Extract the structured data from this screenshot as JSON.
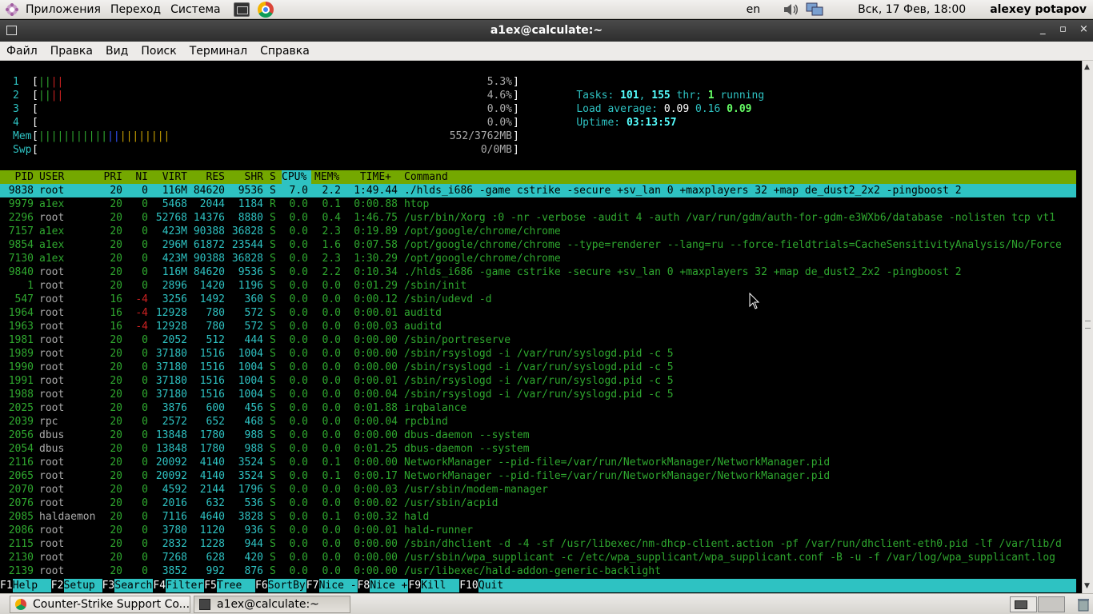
{
  "top_panel": {
    "menus": [
      "Приложения",
      "Переход",
      "Система"
    ],
    "keyboard_layout": "en",
    "clock": "Вск, 17 Фев, 18:00",
    "user": "alexey potapov",
    "launchers": [
      "terminal-launcher-icon",
      "chrome-launcher-icon"
    ]
  },
  "window": {
    "title": "a1ex@calculate:~",
    "controls": [
      "_",
      "▫",
      "×"
    ]
  },
  "menubar": [
    "Файл",
    "Правка",
    "Вид",
    "Поиск",
    "Терминал",
    "Справка"
  ],
  "htop": {
    "cpus": [
      {
        "label": "1",
        "bars": "||||",
        "percent": "5.3%"
      },
      {
        "label": "2",
        "bars": "||||",
        "percent": "4.6%"
      },
      {
        "label": "3",
        "bars": "",
        "percent": "0.0%"
      },
      {
        "label": "4",
        "bars": "",
        "percent": "0.0%"
      }
    ],
    "mem": {
      "label": "Mem",
      "bars": "||||||||||||||||||||||||||||||||||||||",
      "value": "552/3762MB"
    },
    "swp": {
      "label": "Swp",
      "value": "0/0MB"
    },
    "tasks": {
      "label": "Tasks: ",
      "count": "101",
      "sep": ", ",
      "threads": "155",
      "thr_label": " thr; ",
      "running": "1",
      "running_label": " running"
    },
    "load": {
      "label": "Load average: ",
      "l1": "0.09",
      "l5": "0.16",
      "l15": "0.09"
    },
    "uptime": {
      "label": "Uptime: ",
      "value": "03:13:57"
    },
    "columns": [
      "PID",
      "USER",
      "PRI",
      "NI",
      "VIRT",
      "RES",
      "SHR",
      "S",
      "CPU%",
      "MEM%",
      "TIME+",
      "Command"
    ],
    "processes": [
      {
        "pid": "9838",
        "user": "root",
        "pri": "20",
        "ni": "0",
        "virt": "116M",
        "res": "84620",
        "shr": "9536",
        "s": "S",
        "cpu": "7.0",
        "mem": "2.2",
        "time": "1:49.44",
        "cmd": "./hlds_i686 -game cstrike -secure +sv_lan 0 +maxplayers 32 +map de_dust2_2x2 -pingboost 2",
        "selected": true
      },
      {
        "pid": "9979",
        "user": "a1ex",
        "pri": "20",
        "ni": "0",
        "virt": "5468",
        "res": "2044",
        "shr": "1184",
        "s": "R",
        "cpu": "0.0",
        "mem": "0.1",
        "time": "0:00.88",
        "cmd": "htop"
      },
      {
        "pid": "2296",
        "user": "root",
        "pri": "20",
        "ni": "0",
        "virt": "52768",
        "res": "14376",
        "shr": "8880",
        "s": "S",
        "cpu": "0.0",
        "mem": "0.4",
        "time": "1:46.75",
        "cmd": "/usr/bin/Xorg :0 -nr -verbose -audit 4 -auth /var/run/gdm/auth-for-gdm-e3WXb6/database -nolisten tcp vt1"
      },
      {
        "pid": "7157",
        "user": "a1ex",
        "pri": "20",
        "ni": "0",
        "virt": "423M",
        "res": "90388",
        "shr": "36828",
        "s": "S",
        "cpu": "0.0",
        "mem": "2.3",
        "time": "0:19.89",
        "cmd": "/opt/google/chrome/chrome"
      },
      {
        "pid": "9854",
        "user": "a1ex",
        "pri": "20",
        "ni": "0",
        "virt": "296M",
        "res": "61872",
        "shr": "23544",
        "s": "S",
        "cpu": "0.0",
        "mem": "1.6",
        "time": "0:07.58",
        "cmd": "/opt/google/chrome/chrome --type=renderer --lang=ru --force-fieldtrials=CacheSensitivityAnalysis/No/Force"
      },
      {
        "pid": "7130",
        "user": "a1ex",
        "pri": "20",
        "ni": "0",
        "virt": "423M",
        "res": "90388",
        "shr": "36828",
        "s": "S",
        "cpu": "0.0",
        "mem": "2.3",
        "time": "1:30.29",
        "cmd": "/opt/google/chrome/chrome"
      },
      {
        "pid": "9840",
        "user": "root",
        "pri": "20",
        "ni": "0",
        "virt": "116M",
        "res": "84620",
        "shr": "9536",
        "s": "S",
        "cpu": "0.0",
        "mem": "2.2",
        "time": "0:10.34",
        "cmd": "./hlds_i686 -game cstrike -secure +sv_lan 0 +maxplayers 32 +map de_dust2_2x2 -pingboost 2"
      },
      {
        "pid": "1",
        "user": "root",
        "pri": "20",
        "ni": "0",
        "virt": "2896",
        "res": "1420",
        "shr": "1196",
        "s": "S",
        "cpu": "0.0",
        "mem": "0.0",
        "time": "0:01.29",
        "cmd": "/sbin/init"
      },
      {
        "pid": "547",
        "user": "root",
        "pri": "16",
        "ni": "-4",
        "virt": "3256",
        "res": "1492",
        "shr": "360",
        "s": "S",
        "cpu": "0.0",
        "mem": "0.0",
        "time": "0:00.12",
        "cmd": "/sbin/udevd -d"
      },
      {
        "pid": "1964",
        "user": "root",
        "pri": "16",
        "ni": "-4",
        "virt": "12928",
        "res": "780",
        "shr": "572",
        "s": "S",
        "cpu": "0.0",
        "mem": "0.0",
        "time": "0:00.01",
        "cmd": "auditd"
      },
      {
        "pid": "1963",
        "user": "root",
        "pri": "16",
        "ni": "-4",
        "virt": "12928",
        "res": "780",
        "shr": "572",
        "s": "S",
        "cpu": "0.0",
        "mem": "0.0",
        "time": "0:00.03",
        "cmd": "auditd"
      },
      {
        "pid": "1981",
        "user": "root",
        "pri": "20",
        "ni": "0",
        "virt": "2052",
        "res": "512",
        "shr": "444",
        "s": "S",
        "cpu": "0.0",
        "mem": "0.0",
        "time": "0:00.00",
        "cmd": "/sbin/portreserve"
      },
      {
        "pid": "1989",
        "user": "root",
        "pri": "20",
        "ni": "0",
        "virt": "37180",
        "res": "1516",
        "shr": "1004",
        "s": "S",
        "cpu": "0.0",
        "mem": "0.0",
        "time": "0:00.00",
        "cmd": "/sbin/rsyslogd -i /var/run/syslogd.pid -c 5"
      },
      {
        "pid": "1990",
        "user": "root",
        "pri": "20",
        "ni": "0",
        "virt": "37180",
        "res": "1516",
        "shr": "1004",
        "s": "S",
        "cpu": "0.0",
        "mem": "0.0",
        "time": "0:00.00",
        "cmd": "/sbin/rsyslogd -i /var/run/syslogd.pid -c 5"
      },
      {
        "pid": "1991",
        "user": "root",
        "pri": "20",
        "ni": "0",
        "virt": "37180",
        "res": "1516",
        "shr": "1004",
        "s": "S",
        "cpu": "0.0",
        "mem": "0.0",
        "time": "0:00.01",
        "cmd": "/sbin/rsyslogd -i /var/run/syslogd.pid -c 5"
      },
      {
        "pid": "1988",
        "user": "root",
        "pri": "20",
        "ni": "0",
        "virt": "37180",
        "res": "1516",
        "shr": "1004",
        "s": "S",
        "cpu": "0.0",
        "mem": "0.0",
        "time": "0:00.04",
        "cmd": "/sbin/rsyslogd -i /var/run/syslogd.pid -c 5"
      },
      {
        "pid": "2025",
        "user": "root",
        "pri": "20",
        "ni": "0",
        "virt": "3876",
        "res": "600",
        "shr": "456",
        "s": "S",
        "cpu": "0.0",
        "mem": "0.0",
        "time": "0:01.88",
        "cmd": "irqbalance"
      },
      {
        "pid": "2039",
        "user": "rpc",
        "pri": "20",
        "ni": "0",
        "virt": "2572",
        "res": "652",
        "shr": "468",
        "s": "S",
        "cpu": "0.0",
        "mem": "0.0",
        "time": "0:00.04",
        "cmd": "rpcbind"
      },
      {
        "pid": "2056",
        "user": "dbus",
        "pri": "20",
        "ni": "0",
        "virt": "13848",
        "res": "1780",
        "shr": "988",
        "s": "S",
        "cpu": "0.0",
        "mem": "0.0",
        "time": "0:00.00",
        "cmd": "dbus-daemon --system"
      },
      {
        "pid": "2054",
        "user": "dbus",
        "pri": "20",
        "ni": "0",
        "virt": "13848",
        "res": "1780",
        "shr": "988",
        "s": "S",
        "cpu": "0.0",
        "mem": "0.0",
        "time": "0:01.25",
        "cmd": "dbus-daemon --system"
      },
      {
        "pid": "2116",
        "user": "root",
        "pri": "20",
        "ni": "0",
        "virt": "20092",
        "res": "4140",
        "shr": "3524",
        "s": "S",
        "cpu": "0.0",
        "mem": "0.1",
        "time": "0:00.00",
        "cmd": "NetworkManager --pid-file=/var/run/NetworkManager/NetworkManager.pid"
      },
      {
        "pid": "2065",
        "user": "root",
        "pri": "20",
        "ni": "0",
        "virt": "20092",
        "res": "4140",
        "shr": "3524",
        "s": "S",
        "cpu": "0.0",
        "mem": "0.1",
        "time": "0:00.17",
        "cmd": "NetworkManager --pid-file=/var/run/NetworkManager/NetworkManager.pid"
      },
      {
        "pid": "2070",
        "user": "root",
        "pri": "20",
        "ni": "0",
        "virt": "4592",
        "res": "2144",
        "shr": "1796",
        "s": "S",
        "cpu": "0.0",
        "mem": "0.0",
        "time": "0:00.03",
        "cmd": "/usr/sbin/modem-manager"
      },
      {
        "pid": "2076",
        "user": "root",
        "pri": "20",
        "ni": "0",
        "virt": "2016",
        "res": "632",
        "shr": "536",
        "s": "S",
        "cpu": "0.0",
        "mem": "0.0",
        "time": "0:00.02",
        "cmd": "/usr/sbin/acpid"
      },
      {
        "pid": "2085",
        "user": "haldaemon",
        "pri": "20",
        "ni": "0",
        "virt": "7116",
        "res": "4640",
        "shr": "3828",
        "s": "S",
        "cpu": "0.0",
        "mem": "0.1",
        "time": "0:00.32",
        "cmd": "hald"
      },
      {
        "pid": "2086",
        "user": "root",
        "pri": "20",
        "ni": "0",
        "virt": "3780",
        "res": "1120",
        "shr": "936",
        "s": "S",
        "cpu": "0.0",
        "mem": "0.0",
        "time": "0:00.01",
        "cmd": "hald-runner"
      },
      {
        "pid": "2115",
        "user": "root",
        "pri": "20",
        "ni": "0",
        "virt": "2832",
        "res": "1228",
        "shr": "944",
        "s": "S",
        "cpu": "0.0",
        "mem": "0.0",
        "time": "0:00.00",
        "cmd": "/sbin/dhclient -d -4 -sf /usr/libexec/nm-dhcp-client.action -pf /var/run/dhclient-eth0.pid -lf /var/lib/d"
      },
      {
        "pid": "2130",
        "user": "root",
        "pri": "20",
        "ni": "0",
        "virt": "7268",
        "res": "628",
        "shr": "420",
        "s": "S",
        "cpu": "0.0",
        "mem": "0.0",
        "time": "0:00.00",
        "cmd": "/usr/sbin/wpa_supplicant -c /etc/wpa_supplicant/wpa_supplicant.conf -B -u -f /var/log/wpa_supplicant.log"
      },
      {
        "pid": "2139",
        "user": "root",
        "pri": "20",
        "ni": "0",
        "virt": "3852",
        "res": "992",
        "shr": "876",
        "s": "S",
        "cpu": "0.0",
        "mem": "0.0",
        "time": "0:00.00",
        "cmd": "/usr/libexec/hald-addon-generic-backlight"
      }
    ],
    "function_keys": [
      {
        "key": "F1",
        "label": "Help  "
      },
      {
        "key": "F2",
        "label": "Setup "
      },
      {
        "key": "F3",
        "label": "Search"
      },
      {
        "key": "F4",
        "label": "Filter"
      },
      {
        "key": "F5",
        "label": "Tree  "
      },
      {
        "key": "F6",
        "label": "SortBy"
      },
      {
        "key": "F7",
        "label": "Nice -"
      },
      {
        "key": "F8",
        "label": "Nice +"
      },
      {
        "key": "F9",
        "label": "Kill  "
      },
      {
        "key": "F10",
        "label": "Quit"
      }
    ]
  },
  "taskbar": {
    "tasks": [
      {
        "label": "Counter-Strike Support Co...",
        "icon": "chrome-icon"
      },
      {
        "label": "a1ex@calculate:~",
        "icon": "terminal-icon",
        "active": true
      }
    ]
  },
  "colors": {
    "header_bg": "#74a800",
    "selected_bg": "#2ec2c2",
    "text_green": "#2fa82f",
    "cpu_bar_red": "#cc2222",
    "mem_bar_blue": "#3355ff",
    "mem_bar_yellow": "#c8a000"
  }
}
